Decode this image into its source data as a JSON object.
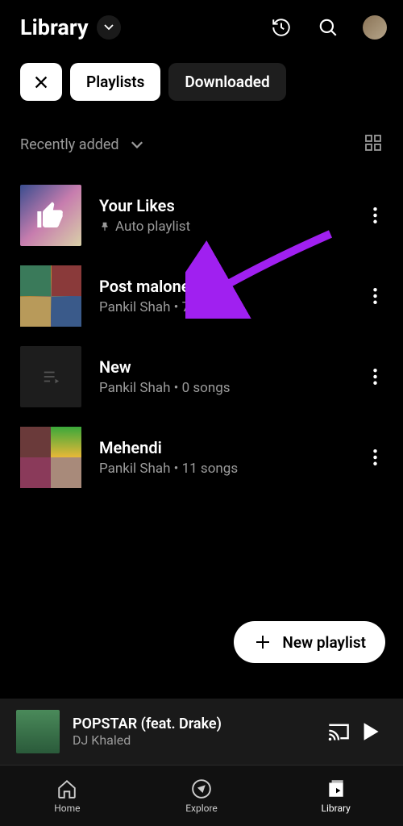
{
  "header": {
    "title": "Library"
  },
  "chips": {
    "playlists": "Playlists",
    "downloaded": "Downloaded"
  },
  "sort": {
    "label": "Recently added"
  },
  "items": [
    {
      "title": "Your Likes",
      "subtitle": "Auto playlist",
      "pinned": true
    },
    {
      "title": "Post malone",
      "subtitle": "Pankil Shah • 7 songs"
    },
    {
      "title": "New",
      "subtitle": "Pankil Shah • 0 songs"
    },
    {
      "title": "Mehendi",
      "subtitle": "Pankil Shah • 11 songs"
    }
  ],
  "fab": {
    "label": "New playlist"
  },
  "player": {
    "title": "POPSTAR (feat. Drake)",
    "artist": "DJ Khaled"
  },
  "nav": {
    "home": "Home",
    "explore": "Explore",
    "library": "Library"
  }
}
